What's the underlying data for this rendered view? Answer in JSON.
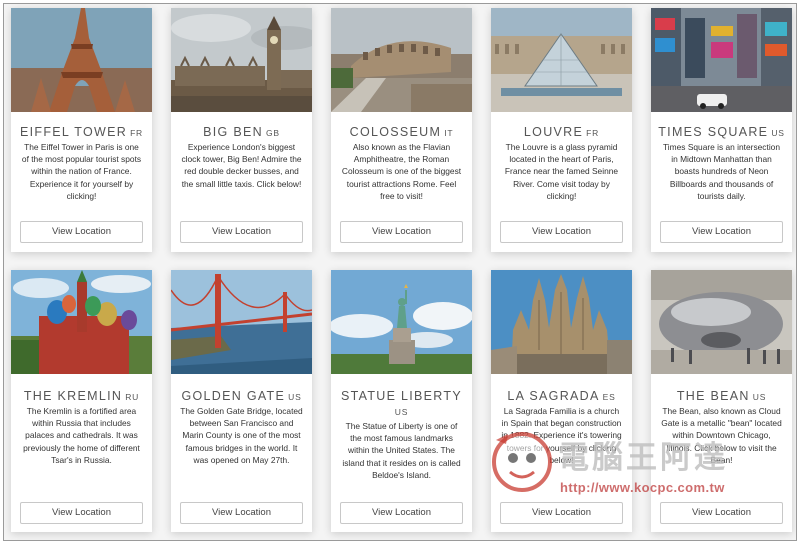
{
  "button_label": "View Location",
  "cards": [
    {
      "title": "EIFFEL TOWER",
      "country": "FR",
      "description": "The Eiffel Tower in Paris is one of the most popular tourist spots within the nation of France. Experience it for yourself by clicking!"
    },
    {
      "title": "BIG BEN",
      "country": "GB",
      "description": "Experience London's biggest clock tower, Big Ben! Admire the red double decker busses, and the small little taxis. Click below!"
    },
    {
      "title": "COLOSSEUM",
      "country": "IT",
      "description": "Also known as the Flavian Amphitheatre, the Roman Colosseum is one of the biggest tourist attractions Rome. Feel free to visit!"
    },
    {
      "title": "LOUVRE",
      "country": "FR",
      "description": "The Louvre is a glass pyramid located in the heart of Paris, France near the famed Seinne River. Come visit today by clicking!"
    },
    {
      "title": "TIMES SQUARE",
      "country": "US",
      "description": "Times Square is an intersection in Midtown Manhattan than boasts hundreds of Neon Billboards and thousands of tourists daily."
    },
    {
      "title": "THE KREMLIN",
      "country": "RU",
      "description": "The Kremlin is a fortified area within Russia that includes palaces and cathedrals. It was previously the home of different Tsar's in Russia."
    },
    {
      "title": "GOLDEN GATE",
      "country": "US",
      "description": "The Golden Gate Bridge, located between San Francisco and Marin County is one of the most famous bridges in the world. It was opened on May 27th."
    },
    {
      "title": "STATUE LIBERTY",
      "country": "US",
      "description": "The Statue of Liberty is one of the most famous landmarks within the United States. The island that it resides on is called Beldoe's Island."
    },
    {
      "title": "LA SAGRADA",
      "country": "ES",
      "description": "La Sagrada Familia is a church in Spain that began construction in 1882. Experience it's towering towers for yourself by clicking below!"
    },
    {
      "title": "THE BEAN",
      "country": "US",
      "description": "The Bean, also known as Cloud Gate is a metallic \"bean\" located within Downtown Chicago, Illinois. Click below to visit the Bean!"
    }
  ],
  "watermark": {
    "brand": "電腦王阿達",
    "url": "http://www.kocpc.com.tw"
  }
}
